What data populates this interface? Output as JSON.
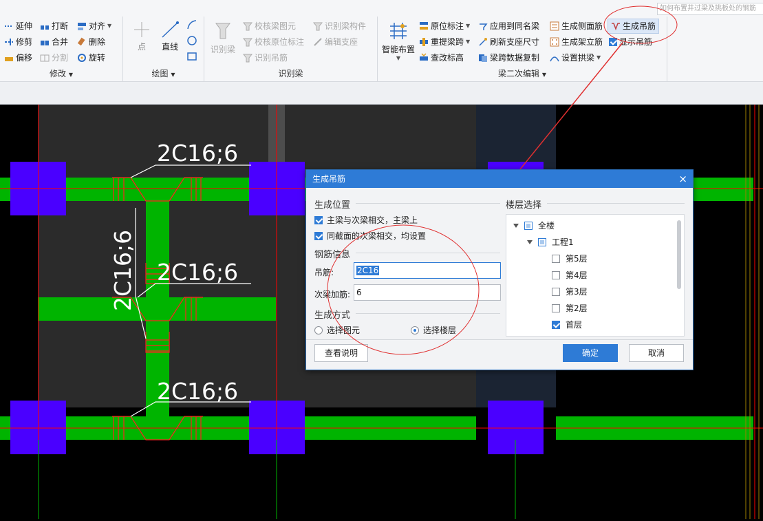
{
  "search": {
    "placeholder": "如何布置井过梁及挑板处的钢筋"
  },
  "ribbon": {
    "modify": {
      "label": "修改",
      "items": [
        "延伸",
        "打断",
        "对齐",
        "修剪",
        "合并",
        "删除",
        "偏移",
        "分割",
        "旋转"
      ]
    },
    "draw": {
      "label": "绘图",
      "point": "点",
      "line": "直线"
    },
    "recognize": {
      "label": "识别梁",
      "big": "识别梁",
      "items": [
        "校核梁图元",
        "识别梁构件",
        "校核原位标注",
        "编辑支座",
        "识别吊筋"
      ]
    },
    "beam2": {
      "label": "梁二次编辑",
      "big": "智能布置",
      "items": [
        "原位标注",
        "应用到同名梁",
        "生成侧面筋",
        "生成吊筋",
        "重提梁跨",
        "刷新支座尺寸",
        "生成架立筋",
        "显示吊筋",
        "查改标高",
        "梁跨数据复制",
        "设置拱梁"
      ]
    }
  },
  "drawing": {
    "annotations": [
      "2C16;6",
      "2C16;6",
      "2C16;6",
      "2C16;6"
    ]
  },
  "dialog": {
    "title": "生成吊筋",
    "close": "×",
    "position_section": "生成位置",
    "pos_opt1": "主梁与次梁相交，主梁上",
    "pos_opt2": "同截面的次梁相交，均设置",
    "rebar_section": "钢筋信息",
    "hanger_label": "吊筋:",
    "hanger_value": "2C16",
    "extra_label": "次梁加筋:",
    "extra_value": "6",
    "method_section": "生成方式",
    "method_opt1": "选择图元",
    "method_opt2": "选择楼层",
    "floor_section": "楼层选择",
    "tree": [
      {
        "label": "全楼",
        "state": "partial"
      },
      {
        "label": "工程1",
        "state": "partial"
      },
      {
        "label": "第5层",
        "state": "unchecked"
      },
      {
        "label": "第4层",
        "state": "unchecked"
      },
      {
        "label": "第3层",
        "state": "unchecked"
      },
      {
        "label": "第2层",
        "state": "unchecked"
      },
      {
        "label": "首层",
        "state": "checked"
      }
    ],
    "help_button": "查看说明",
    "ok_button": "确定",
    "cancel_button": "取消"
  },
  "colors": {
    "beam": "#00b400",
    "column": "#4a00ff",
    "axis": "#ff0000",
    "accent": "#2e7bd6",
    "annotation_circle": "#e03030"
  }
}
